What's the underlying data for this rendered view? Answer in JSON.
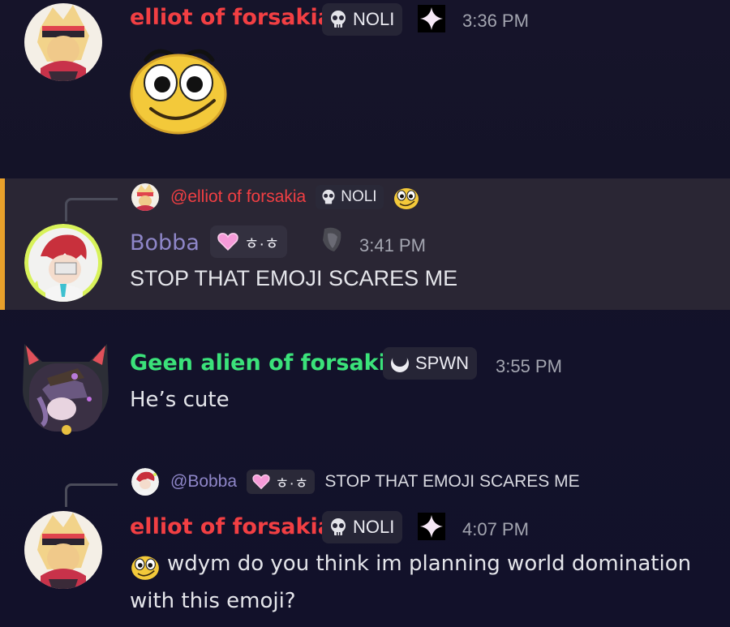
{
  "messages": [
    {
      "username": "elliot of forsakia",
      "username_color": "#f23f43",
      "tag": "NOLI",
      "tag_icon": "skull-icon",
      "extra_icon": "sparkle-icon",
      "time": "3:36 PM",
      "content_emoji": "googly-eyes-smiley-emoji"
    },
    {
      "reply": {
        "username": "@elliot of forsakia",
        "tag": "NOLI",
        "emoji": "googly-eyes-smiley-emoji"
      },
      "username": "Bobba",
      "username_color": "#8e86c8",
      "tag": "ㅎ·ㅎ",
      "tag_icon": "heart-icon",
      "extra_icon": "mask-icon",
      "time": "3:41 PM",
      "text": "STOP THAT EMOJI SCARES ME",
      "highlight_color": "#e8a02b"
    },
    {
      "username": "Geen alien of forsakia",
      "username_color": "#3be27a",
      "tag": "SPWN",
      "tag_icon": "crescent-icon",
      "time": "3:55 PM",
      "text": "He’s cute"
    },
    {
      "reply": {
        "username": "@Bobba",
        "tag": "ㅎ·ㅎ",
        "text": "STOP THAT EMOJI SCARES ME"
      },
      "username": "elliot of forsakia",
      "username_color": "#f23f43",
      "tag": "NOLI",
      "tag_icon": "skull-icon",
      "extra_icon": "sparkle-icon",
      "time": "4:07 PM",
      "text_line1": "wdym do you think im planning world domination",
      "text_line2": "with this emoji?"
    }
  ]
}
